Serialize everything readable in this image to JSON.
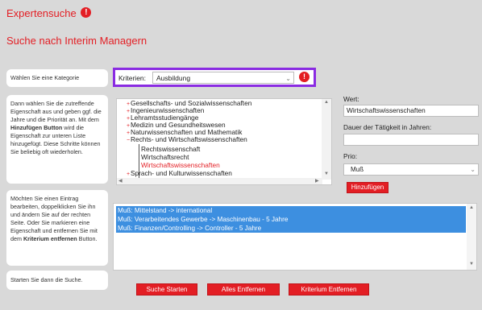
{
  "header": {
    "title": "Expertensuche",
    "title_info_icon": "!",
    "subtitle": "Suche nach Interim Managern"
  },
  "steps": [
    {
      "text": "Wählen Sie eine Kategorie"
    },
    {
      "text_parts": [
        "Dann wählen Sie die zutreffende Eigenschaft aus und geben ggf. die Jahre und die Priorität an. Mit dem ",
        "Hinzufügen Button",
        " wird die Eigenschaft zur unteren Liste hinzugefügt. Diese Schritte können Sie beliebig oft wiederholen."
      ]
    },
    {
      "text_parts": [
        "Möchten Sie einen Eintrag bearbeiten, doppelklicken Sie ihn und ändern Sie auf der rechten Seite. Oder Sie markieren eine Eigenschaft und entfernen Sie mit dem ",
        "Kriterium entfernen",
        " Button."
      ]
    },
    {
      "text": "Starten Sie dann die Suche."
    }
  ],
  "criteria": {
    "label": "Kriterien:",
    "selected": "Ausbildung",
    "info_icon": "!"
  },
  "tree": {
    "items": [
      {
        "label": "Gesellschafts- und Sozialwissenschaften",
        "expandable": true
      },
      {
        "label": "Ingenieurwissenschaften",
        "expandable": true
      },
      {
        "label": "Lehramtsstudiengänge",
        "expandable": true
      },
      {
        "label": "Medizin und Gesundheitswesen",
        "expandable": true
      },
      {
        "label": "Naturwissenschaften und Mathematik",
        "expandable": true
      },
      {
        "label": "Rechts- und Wirtschaftswissenschaften",
        "expandable": true,
        "expanded": true
      }
    ],
    "children": [
      {
        "label": "Rechtswissenschaft",
        "selected": false
      },
      {
        "label": "Wirtschaftsrecht",
        "selected": false
      },
      {
        "label": "Wirtschaftswissenschaften",
        "selected": true
      }
    ],
    "after": [
      {
        "label": "Sprach- und Kulturwissenschaften",
        "expandable": true
      }
    ]
  },
  "form": {
    "wert_label": "Wert:",
    "wert_value": "Wirtschaftswissenschaften",
    "dauer_label": "Dauer der Tätigkeit in Jahren:",
    "dauer_value": "",
    "prio_label": "Prio:",
    "prio_value": "Muß",
    "add_button": "Hinzufügen"
  },
  "results": {
    "rows": [
      "Muß: Mittelstand -> international",
      "Muß: Verarbeitendes Gewerbe -> Maschinenbau - 5 Jahre",
      "Muß: Finanzen/Controlling -> Controller - 5 Jahre"
    ]
  },
  "actions": {
    "start": "Suche Starten",
    "remove_all": "Alles Entfernen",
    "remove_criterion": "Kriterium Entfernen"
  },
  "colors": {
    "accent": "#e31e24",
    "highlight": "#3d8fe0",
    "focus_border": "#8a2be2",
    "background": "#d9d9d9"
  }
}
